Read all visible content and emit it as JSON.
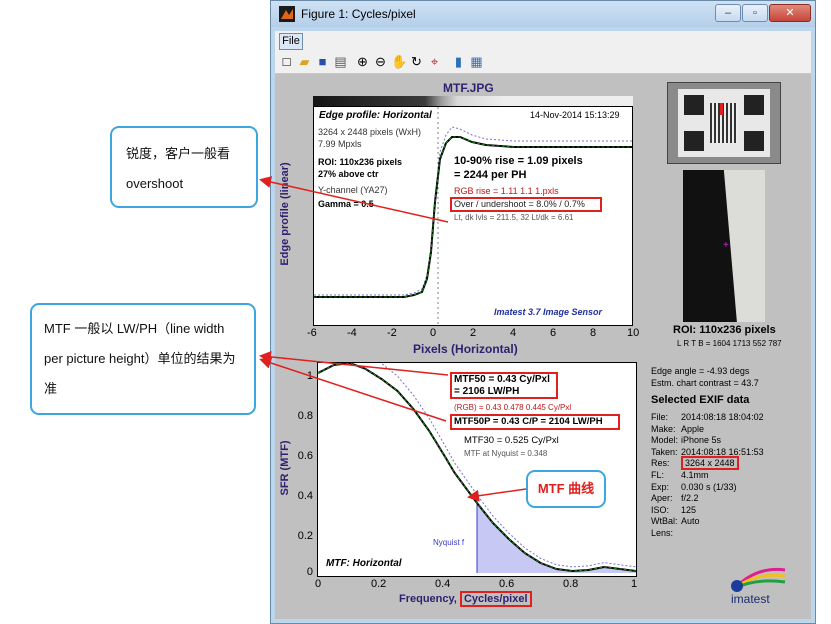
{
  "window": {
    "title": "Figure 1: Cycles/pixel",
    "minimize": "–",
    "maximize": "▫",
    "close": "✕"
  },
  "menu": {
    "file": "File"
  },
  "plot_top": {
    "file_title": "MTF.JPG",
    "heading": "Edge profile: Horizontal",
    "date": "14-Nov-2014 15:13:29",
    "info1": "3264 x 2448 pixels (WxH)",
    "info2": "7.99 Mpxls",
    "roi": "ROI:  110x236 pixels",
    "above_ctr": "27% above ctr",
    "ychannel": "Y-channel  (YA27)",
    "gamma": "Gamma = 0.5",
    "rise1": "10-90% rise = 1.09 pixels",
    "rise2": "= 2244 per PH",
    "rgb_rise": "RGB rise = 1.11  1.1  1.pxls",
    "overshoot": "Over / undershoot = 8.0% / 0.7%",
    "ltdk": "Lt, dk lvls = 211.5, 32   Lt/dk = 6.61",
    "imatest": "Imatest 3.7 Image Sensor",
    "ylabel": "Edge profile (linear)",
    "xlabel": "Pixels (Horizontal)",
    "xticks": [
      "-6",
      "-4",
      "-2",
      "0",
      "2",
      "4",
      "6",
      "8",
      "10"
    ]
  },
  "plot_bottom": {
    "heading": "MTF: Horizontal",
    "ylabel": "SFR (MTF)",
    "xlabel_a": "Frequency, ",
    "xlabel_b": "Cycles/pixel",
    "yticks": [
      "1",
      "0.8",
      "0.6",
      "0.4",
      "0.2",
      "0"
    ],
    "xticks": [
      "0",
      "0.2",
      "0.4",
      "0.6",
      "0.8",
      "1"
    ],
    "mtf50a": "MTF50 = 0.43 Cy/Pxl",
    "mtf50b": "= 2106 LW/PH",
    "rgb": "(RGB) = 0.43  0.478  0.445 Cy/Pxl",
    "mtf50p": "MTF50P = 0.43 C/P = 2104 LW/PH",
    "mtf30": "MTF30 = 0.525 Cy/Pxl",
    "nyq_mtf": "MTF at Nyquist = 0.348",
    "nyquist": "Nyquist f"
  },
  "side": {
    "roi": "ROI:  110x236 pixels",
    "lrtb": "L R T B = 1604 1713  552 787",
    "edge_angle": "Edge angle = -4.93 degs",
    "contrast": "Estm. chart contrast = 43.7",
    "exif_title": "Selected EXIF data",
    "exif": [
      {
        "k": "File:",
        "v": "2014:08:18 18:04:02"
      },
      {
        "k": "Make:",
        "v": "Apple"
      },
      {
        "k": "Model:",
        "v": "iPhone 5s"
      },
      {
        "k": "Taken:",
        "v": "2014:08:18 16:51:53"
      },
      {
        "k": "Res:",
        "v": "3264 x 2448"
      },
      {
        "k": "FL:",
        "v": "4.1mm"
      },
      {
        "k": "Exp:",
        "v": "0.030 s  (1/33)"
      },
      {
        "k": "Aper:",
        "v": "f/2.2"
      },
      {
        "k": "ISO:",
        "v": "125"
      },
      {
        "k": "WtBal:",
        "v": "Auto"
      },
      {
        "k": "Lens:",
        "v": ""
      }
    ],
    "logo": "imatest"
  },
  "annotations": {
    "a1": "锐度，客户一般看 overshoot",
    "a2": "MTF 一般以 LW/PH（line width per picture height）单位的结果为准",
    "a3": "MTF 曲线"
  }
}
